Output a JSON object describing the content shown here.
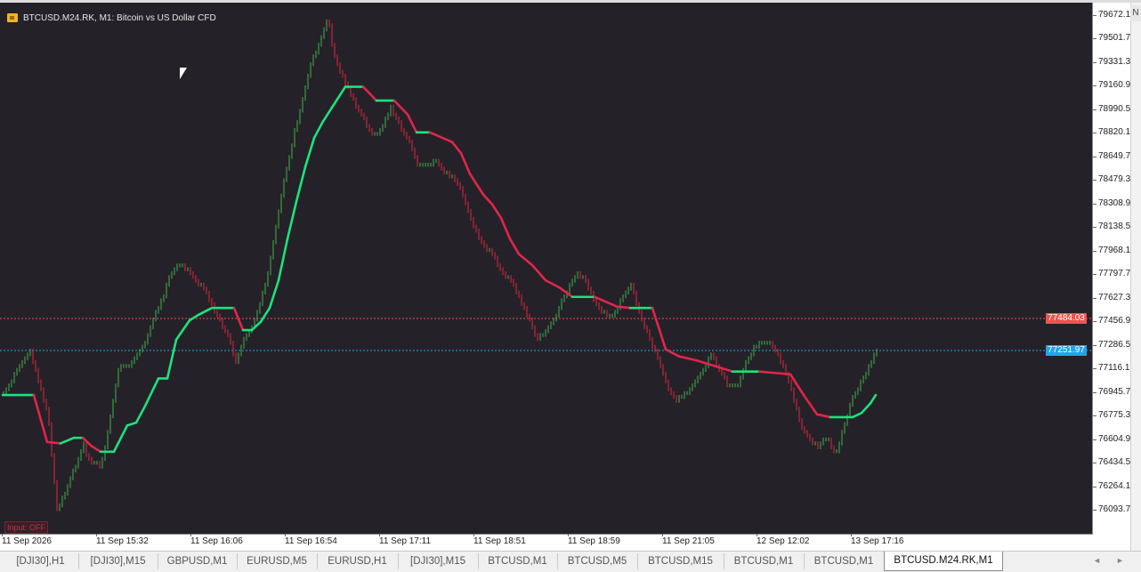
{
  "window": {
    "title": "BTCUSD.M24.RK, M1:  Bitcoin vs US Dollar CFD",
    "inputs_badge": "Input: OFF",
    "corner_label": "N"
  },
  "price_lines": [
    {
      "name": "ask",
      "value": 77484.03,
      "label": "77484.03",
      "color": "#ef5350"
    },
    {
      "name": "bid",
      "value": 77251.97,
      "label": "77251.97",
      "color": "#1ea7e8"
    }
  ],
  "colors": {
    "background": "#252129",
    "bull": "#3fb24a",
    "bear": "#e0263a",
    "line_up": "#1de27a",
    "line_down": "#e0264a"
  },
  "tabs": {
    "items": [
      {
        "label": "[DJI30],H1"
      },
      {
        "label": "[DJI30],M15"
      },
      {
        "label": "GBPUSD,M1"
      },
      {
        "label": "EURUSD,M5"
      },
      {
        "label": "EURUSD,H1"
      },
      {
        "label": "[DJI30],M15"
      },
      {
        "label": "BTCUSD,M1"
      },
      {
        "label": "BTCUSD,M5"
      },
      {
        "label": "BTCUSD,M15"
      },
      {
        "label": "BTCUSD,M1"
      },
      {
        "label": "BTCUSD,M1"
      },
      {
        "label": "BTCUSD.M24.RK,M1"
      }
    ],
    "active_index": 11,
    "nav_left": "◄",
    "nav_right": "►"
  },
  "chart_data": {
    "type": "line",
    "title": "BTCUSD.M24.RK, M1:  Bitcoin vs US Dollar CFD",
    "ylim": [
      76000,
      79700
    ],
    "y_ticks": [
      "79672.1",
      "79501.7",
      "79331.3",
      "79160.9",
      "78990.5",
      "78820.1",
      "78649.7",
      "78479.3",
      "78308.9",
      "78138.5",
      "77968.1",
      "77797.7",
      "77627.3",
      "77456.9",
      "77286.5",
      "77116.1",
      "76945.7",
      "76775.3",
      "76604.9",
      "76434.5",
      "76264.1",
      "76093.7"
    ],
    "x_ticks": [
      "11 Sep 2026",
      "11 Sep 15:32",
      "11 Sep 16:06",
      "11 Sep 16:54",
      "11 Sep 17:11",
      "11 Sep 18:51",
      "11 Sep 18:59",
      "11 Sep 21:05",
      "12 Sep 12:02",
      "13 Sep 17:16"
    ],
    "grid": false,
    "price_series": {
      "name": "",
      "x": [
        0,
        30,
        50,
        60,
        75,
        90,
        95,
        110,
        120,
        130,
        140,
        150,
        160,
        170,
        180,
        185,
        195,
        205,
        215,
        225,
        235,
        245,
        255,
        260,
        270,
        280,
        295,
        305,
        315,
        325,
        335,
        345,
        355,
        365,
        370,
        380,
        395,
        405,
        415,
        425,
        435,
        445,
        455,
        465,
        475,
        485,
        495,
        505,
        515,
        520,
        530,
        540,
        550,
        560,
        570,
        580,
        590,
        600,
        610,
        620,
        630,
        645,
        655,
        665,
        675,
        685,
        695,
        705,
        715,
        725,
        735,
        745,
        755,
        765,
        775,
        785,
        795,
        805,
        815,
        825,
        835,
        845,
        855,
        865,
        875,
        885,
        895,
        905,
        915,
        925,
        935,
        945,
        955,
        965,
        975,
        981
      ],
      "values": [
        76950,
        77250,
        76780,
        76090,
        76320,
        76570,
        76460,
        76420,
        76770,
        77150,
        77130,
        77220,
        77330,
        77520,
        77650,
        77780,
        77870,
        77850,
        77760,
        77700,
        77570,
        77440,
        77320,
        77150,
        77330,
        77440,
        77740,
        78120,
        78470,
        78780,
        79050,
        79320,
        79480,
        79670,
        79400,
        79240,
        79040,
        78920,
        78800,
        78860,
        79010,
        78880,
        78770,
        78600,
        78580,
        78620,
        78540,
        78500,
        78400,
        78280,
        78120,
        78010,
        77940,
        77810,
        77760,
        77620,
        77480,
        77330,
        77400,
        77500,
        77650,
        77820,
        77740,
        77600,
        77520,
        77490,
        77640,
        77730,
        77510,
        77350,
        77190,
        77000,
        76890,
        76930,
        77020,
        77100,
        77220,
        77100,
        76990,
        77010,
        77180,
        77290,
        77320,
        77290,
        77150,
        76970,
        76730,
        76600,
        76560,
        76620,
        76500,
        76720,
        76930,
        77040,
        77180,
        77240
      ]
    },
    "moving_average": {
      "name": "",
      "x": [
        0,
        35,
        50,
        65,
        80,
        90,
        100,
        110,
        125,
        140,
        150,
        160,
        175,
        185,
        195,
        210,
        220,
        235,
        260,
        270,
        280,
        290,
        300,
        310,
        320,
        330,
        340,
        350,
        360,
        370,
        385,
        405,
        420,
        440,
        455,
        465,
        480,
        505,
        515,
        525,
        540,
        550,
        560,
        570,
        580,
        595,
        610,
        625,
        640,
        665,
        690,
        705,
        730,
        745,
        760,
        780,
        800,
        820,
        850,
        885,
        900,
        915,
        930,
        955,
        965,
        975,
        981
      ],
      "values": [
        76930,
        76930,
        76590,
        76580,
        76620,
        76620,
        76560,
        76520,
        76520,
        76710,
        76730,
        76850,
        77050,
        77050,
        77330,
        77470,
        77510,
        77560,
        77560,
        77400,
        77400,
        77460,
        77560,
        77760,
        78060,
        78330,
        78580,
        78790,
        78910,
        79010,
        79160,
        79160,
        79060,
        79060,
        78960,
        78830,
        78830,
        78760,
        78680,
        78530,
        78380,
        78310,
        78210,
        78060,
        77950,
        77870,
        77760,
        77710,
        77640,
        77640,
        77570,
        77560,
        77560,
        77260,
        77210,
        77180,
        77140,
        77100,
        77100,
        77080,
        76930,
        76790,
        76770,
        76770,
        76800,
        76870,
        76930
      ]
    }
  }
}
